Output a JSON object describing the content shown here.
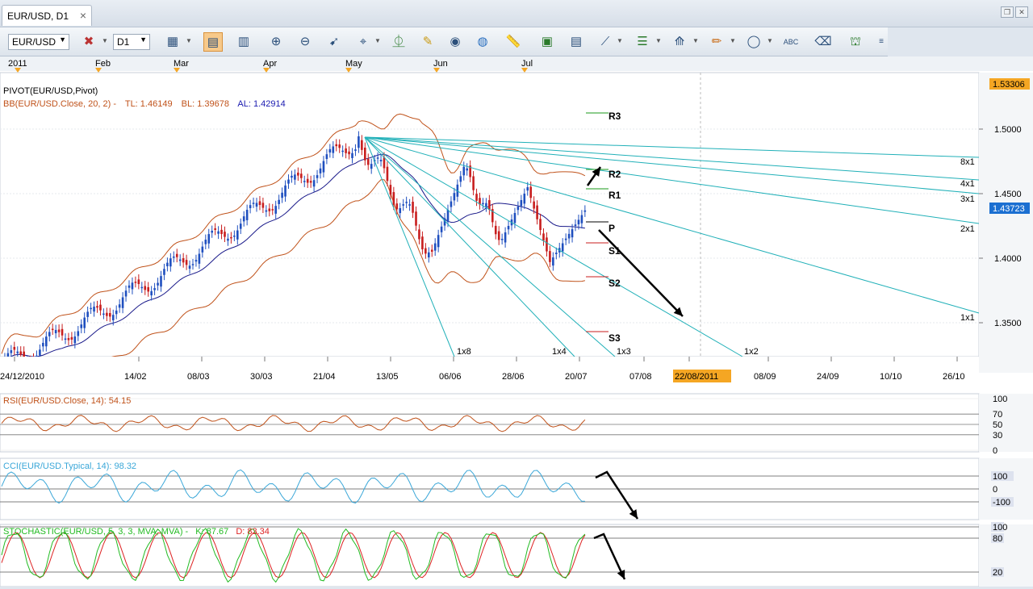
{
  "window": {
    "tab_title": "EUR/USD, D1",
    "tab_close": "×"
  },
  "toolbar": {
    "symbol": "EUR/USD",
    "timeframe": "D1"
  },
  "chart": {
    "top_months": [
      "2011",
      "Feb",
      "Mar",
      "Apr",
      "May",
      "Jun",
      "Jul"
    ],
    "legend_pivot": "PIVOT(EUR/USD,Pivot)",
    "legend_bb_name": "BB(EUR/USD.Close, 20, 2) -",
    "legend_bb_tl": "TL: 1.46149",
    "legend_bb_bl": "BL: 1.39678",
    "legend_bb_al": "AL: 1.42914",
    "price_ticks": [
      "1.5000",
      "1.4500",
      "1.4000",
      "1.3500"
    ],
    "price_top_badge": "1.53306",
    "price_current_badge": "1.43723",
    "pivot_labels": [
      "R3",
      "R2",
      "R1",
      "P",
      "S1",
      "S2",
      "S3"
    ],
    "fan_labels_right": [
      "8x1",
      "4x1",
      "3x1",
      "2x1",
      "1x1"
    ],
    "fan_labels_bottom": [
      "1x8",
      "1x4",
      "1x3",
      "1x2"
    ],
    "date_labels": [
      "24/12/2010",
      "14/02",
      "08/03",
      "30/03",
      "21/04",
      "13/05",
      "06/06",
      "28/06",
      "20/07",
      "07/08",
      "22/08/2011",
      "08/09",
      "24/09",
      "10/10",
      "26/10"
    ],
    "date_cursor": "22/08/2011"
  },
  "rsi": {
    "legend": "RSI(EUR/USD.Close, 14): 54.15",
    "ticks": [
      "100",
      "70",
      "50",
      "30",
      "0"
    ]
  },
  "cci": {
    "legend": "CCI(EUR/USD.Typical, 14): 98.32",
    "ticks": [
      "100",
      "0",
      "-100"
    ]
  },
  "stoch": {
    "legend_main": "STOCHASTIC(EUR/USD, 5, 3, 3, MVA, MVA) -",
    "legend_k": "K: 87.67",
    "legend_d": "D: 83.34",
    "ticks": [
      "100",
      "80",
      "20"
    ]
  },
  "colors": {
    "candle_up": "#1f4fbf",
    "candle_down": "#c81e1e",
    "bb": "#c0521a",
    "bb_mid": "#1a1a8a",
    "fan": "#20b0b8",
    "rsi": "#c0521a",
    "cci": "#3aa7d8",
    "stoch_k": "#22bb22",
    "stoch_d": "#dd2222"
  }
}
